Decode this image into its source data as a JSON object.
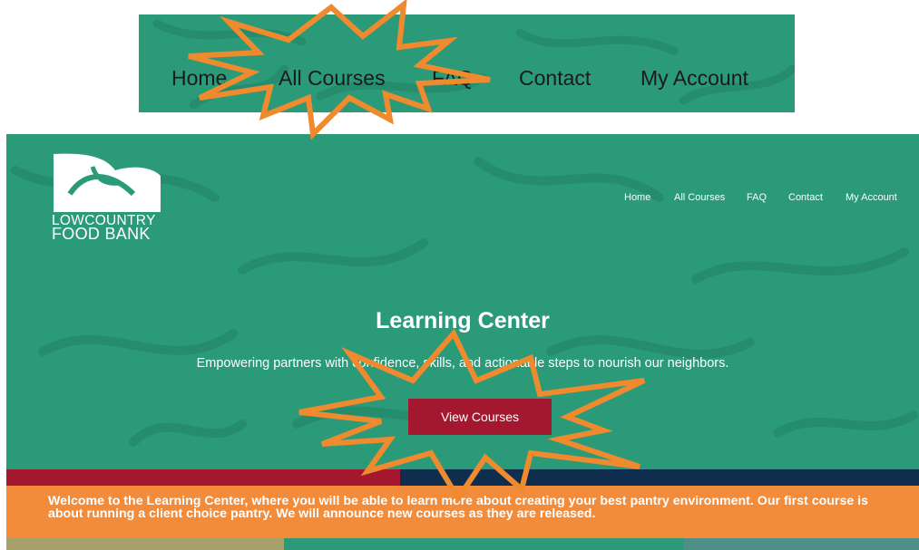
{
  "zoom_nav": {
    "items": [
      "Home",
      "All Courses",
      "FAQ",
      "Contact",
      "My Account"
    ]
  },
  "header": {
    "logo": {
      "line1": "LOWCOUNTRY",
      "line2": "FOOD BANK"
    },
    "nav": [
      "Home",
      "All Courses",
      "FAQ",
      "Contact",
      "My Account"
    ]
  },
  "hero": {
    "title": "Learning Center",
    "subtitle": "Empowering partners with confidence, skills, and actionable steps to nourish our neighbors.",
    "cta_label": "View Courses"
  },
  "welcome": {
    "line1": "Welcome to the Learning Center, where you will be able to learn more about creating your best pantry environment. Our first course is",
    "line2": "about running a client choice pantry. We will announce new courses as they are released."
  },
  "colors": {
    "brand_green": "#2b9a79",
    "accent_red": "#a4182f",
    "navy": "#0f2d4e",
    "orange": "#f28b3a",
    "highlight_orange": "#f08a2e"
  },
  "icons": {
    "highlight": "starburst-icon",
    "logo": "food-bank-leaf-logo-icon"
  }
}
